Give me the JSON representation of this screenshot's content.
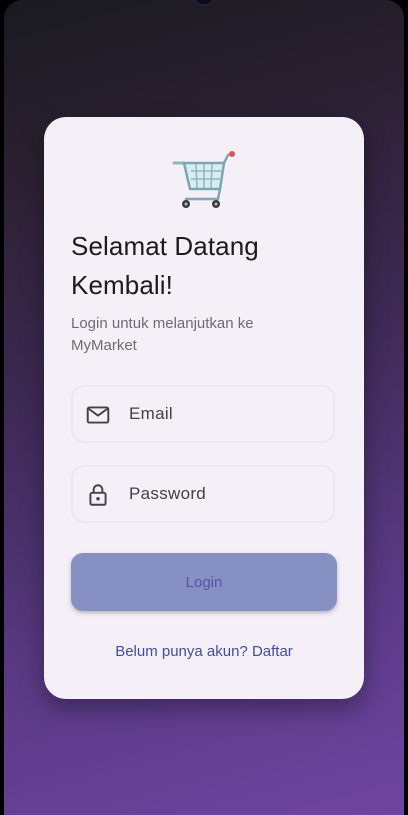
{
  "login": {
    "title": "Selamat Datang Kembali!",
    "subtitle": "Login untuk melanjutkan ke MyMarket",
    "email_placeholder": "Email",
    "password_placeholder": "Password",
    "login_button": "Login",
    "register_link": "Belum punya akun? Daftar"
  },
  "icons": {
    "logo": "shopping-cart",
    "email": "mail-outline",
    "password": "lock-outline"
  },
  "colors": {
    "card_background": "#f5eff7",
    "button_background": "#8690c2",
    "button_text": "#5c54a0",
    "link": "#3f4ea0",
    "background_gradient_end": "#6e45a0"
  }
}
